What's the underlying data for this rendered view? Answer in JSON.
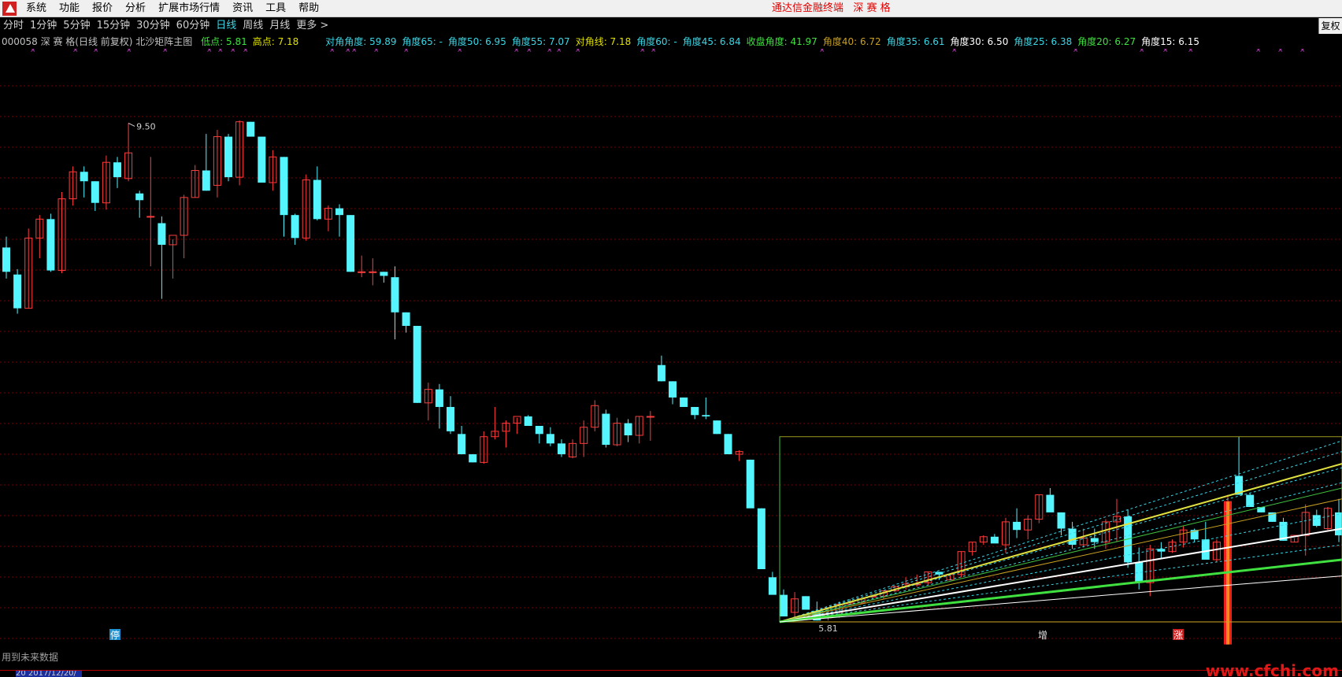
{
  "menu": {
    "items": [
      "系统",
      "功能",
      "报价",
      "分析",
      "扩展市场行情",
      "资讯",
      "工具",
      "帮助"
    ],
    "terminal_title": "通达信金融终端",
    "stock_short_name": "深 赛 格"
  },
  "period_tabs": {
    "items": [
      "分时",
      "1分钟",
      "5分钟",
      "15分钟",
      "30分钟",
      "60分钟",
      "日线",
      "周线",
      "月线",
      "更多 >"
    ],
    "active": "日线",
    "restore_label": "复权"
  },
  "indicator": {
    "stock_code": "000058",
    "stock_name": "深 赛 格",
    "mode": "(日线 前复权)",
    "indicator_name": "北沙矩阵主图",
    "values": [
      {
        "label": "低点:",
        "value": "5.81",
        "color": "#40e040"
      },
      {
        "label": "高点:",
        "value": "7.18",
        "color": "#e0e000"
      },
      {
        "label": "对角角度:",
        "value": "59.89",
        "color": "#3ad6e6"
      },
      {
        "label": "角度65:",
        "value": "-",
        "color": "#3ad6e6"
      },
      {
        "label": "角度50:",
        "value": "6.95",
        "color": "#3ad6e6"
      },
      {
        "label": "角度55:",
        "value": "7.07",
        "color": "#3ad6e6"
      },
      {
        "label": "对角线:",
        "value": "7.18",
        "color": "#e0e000"
      },
      {
        "label": "角度60:",
        "value": "-",
        "color": "#3ad6e6"
      },
      {
        "label": "角度45:",
        "value": "6.84",
        "color": "#3ad6e6"
      },
      {
        "label": "收盘角度:",
        "value": "41.97",
        "color": "#40e040"
      },
      {
        "label": "角度40:",
        "value": "6.72",
        "color": "#c8a020"
      },
      {
        "label": "角度35:",
        "value": "6.61",
        "color": "#3ad6e6"
      },
      {
        "label": "角度30:",
        "value": "6.50",
        "color": "#ffffff"
      },
      {
        "label": "角度25:",
        "value": "6.38",
        "color": "#3ad6e6"
      },
      {
        "label": "角度20:",
        "value": "6.27",
        "color": "#40e040"
      },
      {
        "label": "角度15:",
        "value": "6.15",
        "color": "#ffffff"
      }
    ]
  },
  "chart_data": {
    "type": "candlestick",
    "price_labels": {
      "high": "9.50",
      "low": "5.81"
    },
    "ylim": [
      5.6,
      10.05
    ],
    "colors": {
      "up": "#ff3c3c",
      "down": "#54f5ff",
      "grid": "#7a0000"
    },
    "candles": [
      [
        8.58,
        8.66,
        8.35,
        8.4
      ],
      [
        8.38,
        8.42,
        8.09,
        8.13
      ],
      [
        8.13,
        8.72,
        8.13,
        8.65
      ],
      [
        8.65,
        8.82,
        8.5,
        8.79
      ],
      [
        8.79,
        8.83,
        8.4,
        8.41
      ],
      [
        8.41,
        8.99,
        8.39,
        8.94
      ],
      [
        8.94,
        9.18,
        8.89,
        9.14
      ],
      [
        9.14,
        9.18,
        8.95,
        9.07
      ],
      [
        9.07,
        9.07,
        8.85,
        8.91
      ],
      [
        8.91,
        9.26,
        8.86,
        9.21
      ],
      [
        9.21,
        9.25,
        9.02,
        9.1
      ],
      [
        9.09,
        9.5,
        9.07,
        9.28
      ],
      [
        8.98,
        9.0,
        8.8,
        8.93
      ],
      [
        8.81,
        9.25,
        8.44,
        8.81
      ],
      [
        8.76,
        8.81,
        8.2,
        8.6
      ],
      [
        8.6,
        8.64,
        8.35,
        8.67
      ],
      [
        8.67,
        8.97,
        8.5,
        8.95
      ],
      [
        8.95,
        9.19,
        8.95,
        9.15
      ],
      [
        9.15,
        9.42,
        9.0,
        9.0
      ],
      [
        9.04,
        9.45,
        8.95,
        9.4
      ],
      [
        9.4,
        9.42,
        9.07,
        9.1
      ],
      [
        9.1,
        9.52,
        9.04,
        9.51
      ],
      [
        9.51,
        9.51,
        9.44,
        9.4
      ],
      [
        9.4,
        9.4,
        9.06,
        9.06
      ],
      [
        9.06,
        9.3,
        9.0,
        9.25
      ],
      [
        9.25,
        9.25,
        8.66,
        8.82
      ],
      [
        8.82,
        8.83,
        8.6,
        8.65
      ],
      [
        8.65,
        9.12,
        8.63,
        9.08
      ],
      [
        9.08,
        9.18,
        8.78,
        8.79
      ],
      [
        8.79,
        8.89,
        8.7,
        8.87
      ],
      [
        8.87,
        8.9,
        8.66,
        8.82
      ],
      [
        8.82,
        8.82,
        8.4,
        8.4
      ],
      [
        8.4,
        8.52,
        8.36,
        8.4
      ],
      [
        8.4,
        8.5,
        8.3,
        8.4
      ],
      [
        8.4,
        8.4,
        8.32,
        8.37
      ],
      [
        8.36,
        8.44,
        7.9,
        8.1
      ],
      [
        8.1,
        8.1,
        7.95,
        8.0
      ],
      [
        8.0,
        8.0,
        7.43,
        7.43
      ],
      [
        7.43,
        7.58,
        7.3,
        7.53
      ],
      [
        7.53,
        7.57,
        7.24,
        7.4
      ],
      [
        7.4,
        7.48,
        7.2,
        7.22
      ],
      [
        7.2,
        7.26,
        7.05,
        7.05
      ],
      [
        7.05,
        7.05,
        6.99,
        6.99
      ],
      [
        6.99,
        7.22,
        6.98,
        7.18
      ],
      [
        7.18,
        7.4,
        7.16,
        7.22
      ],
      [
        7.22,
        7.3,
        7.1,
        7.28
      ],
      [
        7.28,
        7.32,
        7.2,
        7.33
      ],
      [
        7.33,
        7.34,
        7.26,
        7.26
      ],
      [
        7.26,
        7.26,
        7.13,
        7.2
      ],
      [
        7.2,
        7.25,
        7.11,
        7.13
      ],
      [
        7.13,
        7.16,
        7.03,
        7.05
      ],
      [
        7.03,
        7.16,
        7.02,
        7.13
      ],
      [
        7.13,
        7.3,
        7.03,
        7.25
      ],
      [
        7.25,
        7.45,
        7.22,
        7.41
      ],
      [
        7.35,
        7.38,
        7.1,
        7.12
      ],
      [
        7.12,
        7.32,
        7.11,
        7.28
      ],
      [
        7.28,
        7.31,
        7.14,
        7.19
      ],
      [
        7.19,
        7.33,
        7.13,
        7.33
      ],
      [
        7.33,
        7.37,
        7.15,
        7.33
      ],
      [
        7.71,
        7.78,
        7.59,
        7.59
      ],
      [
        7.59,
        7.59,
        7.42,
        7.47
      ],
      [
        7.47,
        7.47,
        7.4,
        7.4
      ],
      [
        7.4,
        7.4,
        7.31,
        7.34
      ],
      [
        7.34,
        7.47,
        7.31,
        7.33
      ],
      [
        7.3,
        7.3,
        7.2,
        7.2
      ],
      [
        7.2,
        7.2,
        7.05,
        7.05
      ],
      [
        7.05,
        7.08,
        7.0,
        7.07
      ],
      [
        7.01,
        7.01,
        6.66,
        6.65
      ],
      [
        6.65,
        6.65,
        6.2,
        6.2
      ],
      [
        6.14,
        6.18,
        6.05,
        6.01
      ],
      [
        6.01,
        6.05,
        5.88,
        5.85
      ],
      [
        5.88,
        6.03,
        5.82,
        5.98
      ],
      [
        6.0,
        6.0,
        5.9,
        5.9
      ],
      [
        5.89,
        5.96,
        5.82,
        5.82
      ],
      [
        5.84,
        5.92,
        5.82,
        5.87
      ],
      [
        5.88,
        5.96,
        5.84,
        5.94
      ],
      [
        5.94,
        5.98,
        5.94,
        5.95
      ],
      [
        5.95,
        5.98,
        5.94,
        5.98
      ],
      [
        6.0,
        6.01,
        5.98,
        6.0
      ],
      [
        6.0,
        6.04,
        5.98,
        6.04
      ],
      [
        6.04,
        6.08,
        6.03,
        6.07
      ],
      [
        6.07,
        6.14,
        6.05,
        6.09
      ],
      [
        6.09,
        6.16,
        6.07,
        6.09
      ],
      [
        6.1,
        6.18,
        6.08,
        6.18
      ],
      [
        6.18,
        6.18,
        6.12,
        6.16
      ],
      [
        6.12,
        6.16,
        6.12,
        6.16
      ],
      [
        6.16,
        6.33,
        6.14,
        6.33
      ],
      [
        6.33,
        6.4,
        6.3,
        6.4
      ],
      [
        6.4,
        6.45,
        6.38,
        6.44
      ],
      [
        6.44,
        6.46,
        6.4,
        6.39
      ],
      [
        6.38,
        6.58,
        6.32,
        6.55
      ],
      [
        6.55,
        6.65,
        6.43,
        6.49
      ],
      [
        6.49,
        6.6,
        6.42,
        6.57
      ],
      [
        6.57,
        6.75,
        6.54,
        6.75
      ],
      [
        6.75,
        6.8,
        6.65,
        6.62
      ],
      [
        6.62,
        6.62,
        6.45,
        6.5
      ],
      [
        6.5,
        6.55,
        6.35,
        6.38
      ],
      [
        6.38,
        6.5,
        6.36,
        6.43
      ],
      [
        6.43,
        6.5,
        6.35,
        6.4
      ],
      [
        6.4,
        6.57,
        6.35,
        6.55
      ],
      [
        6.55,
        6.72,
        6.4,
        6.59
      ],
      [
        6.59,
        6.64,
        6.21,
        6.25
      ],
      [
        6.25,
        6.36,
        6.05,
        6.1
      ],
      [
        6.1,
        6.38,
        6.0,
        6.35
      ],
      [
        6.35,
        6.4,
        6.28,
        6.33
      ],
      [
        6.33,
        6.42,
        6.32,
        6.4
      ],
      [
        6.4,
        6.52,
        6.36,
        6.49
      ],
      [
        6.49,
        6.5,
        6.4,
        6.42
      ],
      [
        6.42,
        6.55,
        6.31,
        6.27
      ],
      [
        6.27,
        6.42,
        6.25,
        6.4
      ],
      [
        6.4,
        6.75,
        6.28,
        6.7
      ],
      [
        6.89,
        7.18,
        6.75,
        6.75
      ],
      [
        6.75,
        6.76,
        6.66,
        6.66
      ],
      [
        6.66,
        6.66,
        6.62,
        6.62
      ],
      [
        6.62,
        6.62,
        6.55,
        6.55
      ],
      [
        6.55,
        6.58,
        6.41,
        6.41
      ],
      [
        6.4,
        6.43,
        6.4,
        6.45
      ],
      [
        6.45,
        6.68,
        6.3,
        6.62
      ],
      [
        6.6,
        6.64,
        6.51,
        6.52
      ],
      [
        6.5,
        6.66,
        6.49,
        6.65
      ],
      [
        6.62,
        6.72,
        6.4,
        6.45
      ],
      [
        6.45,
        6.68,
        6.44,
        6.67
      ],
      [
        6.67,
        6.71,
        6.53,
        6.64
      ],
      [
        6.64,
        6.65,
        6.6,
        6.6
      ],
      [
        6.6,
        6.7,
        6.58,
        6.65
      ]
    ]
  },
  "footnote": "用到未来数据",
  "bottom_marks": {
    "ting": "停",
    "zeng": "增",
    "zhang": "涨"
  },
  "date_strip": {
    "label": "20 2017/12/20/"
  },
  "watermark": "www.cfchi.com"
}
